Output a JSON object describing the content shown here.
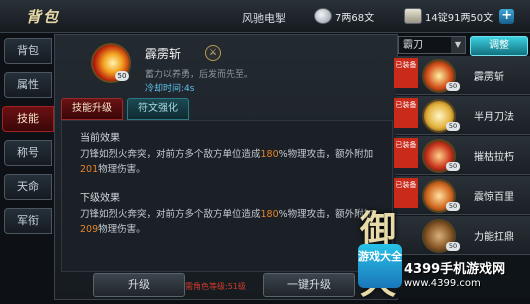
{
  "header": {
    "title": "背包",
    "player_name": "风驰电掣",
    "silver": "7两68文",
    "gold": "14锭91两50文",
    "plus_label": "+"
  },
  "left_tabs": [
    "背包",
    "属性",
    "技能",
    "称号",
    "天命",
    "军衔"
  ],
  "active_left_tab": "技能",
  "skill": {
    "name": "霹雳斩",
    "level": "50",
    "description": "蓄力以养勇，后发而先至。",
    "cooldown": "冷却时间:4s",
    "sword_glyph": "⚔"
  },
  "tabs": [
    "技能升级",
    "符文强化"
  ],
  "active_tab": "技能升级",
  "current": {
    "title": "当前效果",
    "pre": "刀锋如烈火奔突，对前方多个敌方单位造成",
    "pct": "180",
    "mid": "%物理攻击，额外附加",
    "dmg": "201",
    "post": "物理伤害。"
  },
  "next": {
    "title": "下级效果",
    "pre": "刀锋如烈火奔突，对前方多个敌方单位造成",
    "pct": "180",
    "mid": "%物理攻击，额外附加",
    "dmg": "209",
    "post": "物理伤害。"
  },
  "buttons": {
    "upgrade": "升级",
    "requirement": "需角色等级:51级",
    "upgrade_all": "一键升级"
  },
  "weapon_select": {
    "value": "霸刀",
    "arrow": "▼"
  },
  "swap_label": "调整",
  "skill_list": [
    {
      "name": "霹雳斩",
      "level": "50",
      "equipped": "已装备",
      "color": "#d3521c"
    },
    {
      "name": "半月刀法",
      "level": "50",
      "equipped": "已装备",
      "color": "#e3b23c"
    },
    {
      "name": "摧枯拉朽",
      "level": "50",
      "equipped": "已装备",
      "color": "#c9361c"
    },
    {
      "name": "震惊百里",
      "level": "50",
      "equipped": "已装备",
      "color": "#d26a22"
    },
    {
      "name": "力能扛鼎",
      "level": "50",
      "equipped": "",
      "color": "#8a5a2a"
    }
  ],
  "watermark": {
    "logo": "御天",
    "box": "游戏大全",
    "site_cn": "4399手机游戏网",
    "site_url": "www.4399.com"
  }
}
